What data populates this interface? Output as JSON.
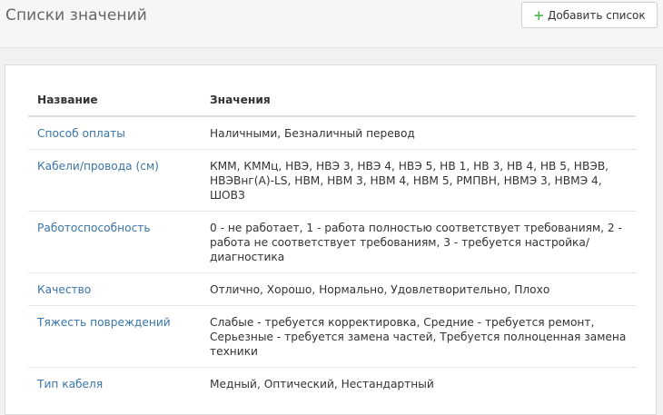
{
  "header": {
    "title": "Списки значений",
    "add_button_label": "Добавить список",
    "add_icon": "plus-icon"
  },
  "table": {
    "columns": [
      "Название",
      "Значения"
    ],
    "rows": [
      {
        "name": "Способ оплаты",
        "values": "Наличными, Безналичный перевод"
      },
      {
        "name": "Кабели/провода (см)",
        "values": "КММ, КММц, НВЭ, НВЭ 3, НВЭ 4, НВЭ 5, НВ 1, НВ 3, НВ 4, НВ 5, НВЭВ, НВЭВнг(А)-LS, НВМ, НВМ 3, НВМ 4, НВМ 5, РМПВН, НВМЭ 3, НВМЭ 4, ШОВЗ"
      },
      {
        "name": "Работоспособность",
        "values": "0 - не работает, 1 - работа полностью соответствует требованиям, 2 - работа не соответствует требованиям, 3 - требуется настройка/диагностика"
      },
      {
        "name": "Качество",
        "values": "Отлично, Хорошо, Нормально, Удовлетворительно, Плохо"
      },
      {
        "name": "Тяжесть повреждений",
        "values": "Слабые - требуется корректировка, Средние - требуется ремонт, Серьезные - требуется замена частей, Требуется полноценная замена техники"
      },
      {
        "name": "Тип кабеля",
        "values": "Медный, Оптический, Нестандартный"
      }
    ]
  },
  "colors": {
    "link": "#3a75a8",
    "accent_green": "#5cb85c"
  }
}
